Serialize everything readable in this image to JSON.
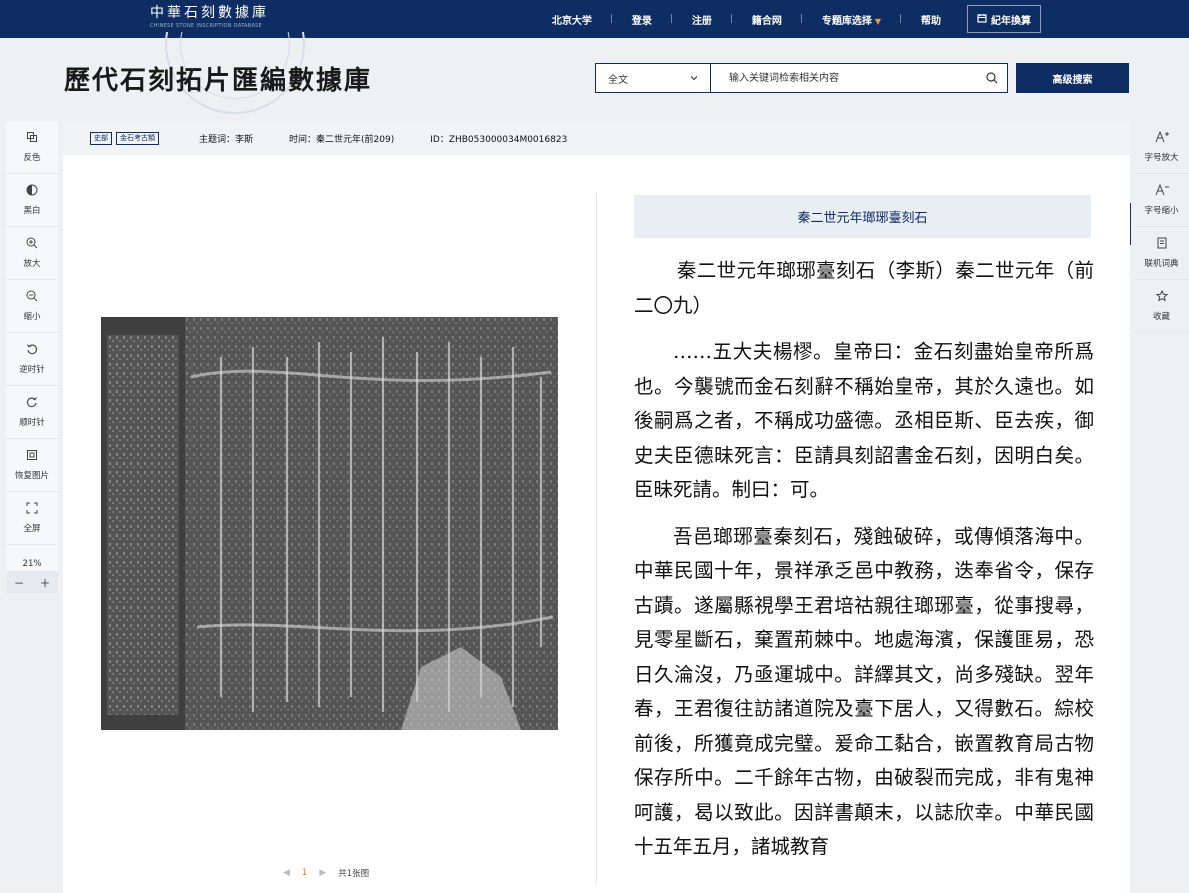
{
  "topbar": {
    "brand_cn": "中華石刻數據庫",
    "brand_en": "CHINESE STONE INSCRIPTION DATABASE",
    "nav": [
      "北京大学",
      "登录",
      "注册",
      "籍合网",
      "专题库选择",
      "帮助"
    ],
    "convert_label": "紀年換算"
  },
  "header": {
    "title": "歷代石刻拓片匯編數據庫",
    "search_scope": "全文",
    "search_placeholder": "输入关键词检索相关内容",
    "advanced_label": "高级搜索"
  },
  "left_tools": [
    "反色",
    "黑白",
    "放大",
    "缩小",
    "逆时针",
    "顺时针",
    "恢复图片",
    "全屏"
  ],
  "zoom": {
    "percent": "21%",
    "minus": "−",
    "plus": "+"
  },
  "right_tools": [
    "字号放大",
    "字号缩小",
    "联机词典",
    "收藏"
  ],
  "meta": {
    "tags": [
      "史部",
      "金石考古類"
    ],
    "subject": "主题词：李斯",
    "time": "时间：秦二世元年(前209)",
    "id": "ID：ZHB053000034M0016823"
  },
  "pager": {
    "prev": "◀",
    "page": "1",
    "next": "▶",
    "total": "共1张图"
  },
  "text": {
    "heading": "秦二世元年瑯琊臺刻石",
    "paragraphs": [
      "秦二世元年瑯琊臺刻石（李斯）秦二世元年（前二〇九）",
      "……五大夫楊樛。皇帝曰：金石刻盡始皇帝所爲也。今襲號而金石刻辭不稱始皇帝，其於久遠也。如後嗣爲之者，不稱成功盛德。丞相臣斯、臣去疾，御史夫臣德昧死言：臣請具刻詔書金石刻，因明白矣。臣昧死請。制曰：可。",
      "吾邑瑯琊臺秦刻石，殘蝕破碎，或傳傾落海中。中華民國十年，景祥承乏邑中教務，迭奉省令，保存古蹟。遂屬縣視學王君培祜親往瑯琊臺，從事搜尋，見零星斷石，棄置荊棘中。地處海濱，保護匪易，恐日久淪沒，乃亟運城中。詳繹其文，尚多殘缺。翌年春，王君復往訪諸道院及臺下居人，又得數石。綜校前後，所獲竟成完璧。爰命工黏合，嵌置教育局古物保存所中。二千餘年古物，由破裂而完成，非有鬼神呵護，曷以致此。因詳書顛末，以誌欣幸。中華民國十五年五月，諸城教育"
    ]
  },
  "colors": {
    "navy": "#0e2d62",
    "accent": "#e07a2a"
  }
}
